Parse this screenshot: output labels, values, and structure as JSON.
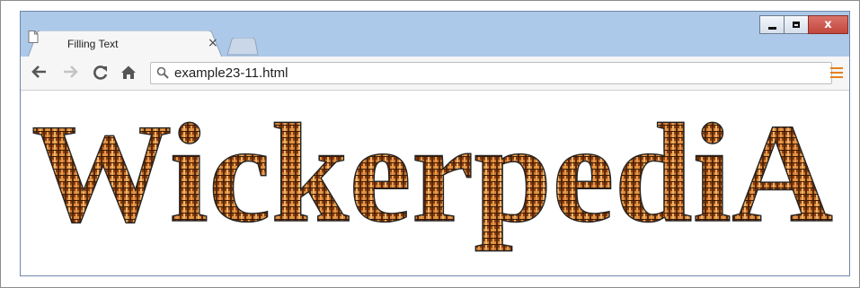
{
  "browser": {
    "tab": {
      "title": "Filling Text",
      "close_glyph": "×"
    },
    "window_controls": {
      "minimize": "minimize-icon",
      "maximize": "maximize-icon",
      "close": "x"
    },
    "toolbar": {
      "back_icon": "back-arrow-icon",
      "forward_icon": "forward-arrow-icon",
      "reload_icon": "reload-icon",
      "home_icon": "home-icon",
      "url": "example23-11.html",
      "menu_icon": "hamburger-menu-icon"
    }
  },
  "page": {
    "heading": "WickerpediA",
    "fill": "wicker-texture",
    "colors": {
      "wicker_dark": "#4a2306",
      "wicker_mid": "#a5521a",
      "wicker_light": "#e6a25a",
      "outline": "#222222"
    }
  }
}
